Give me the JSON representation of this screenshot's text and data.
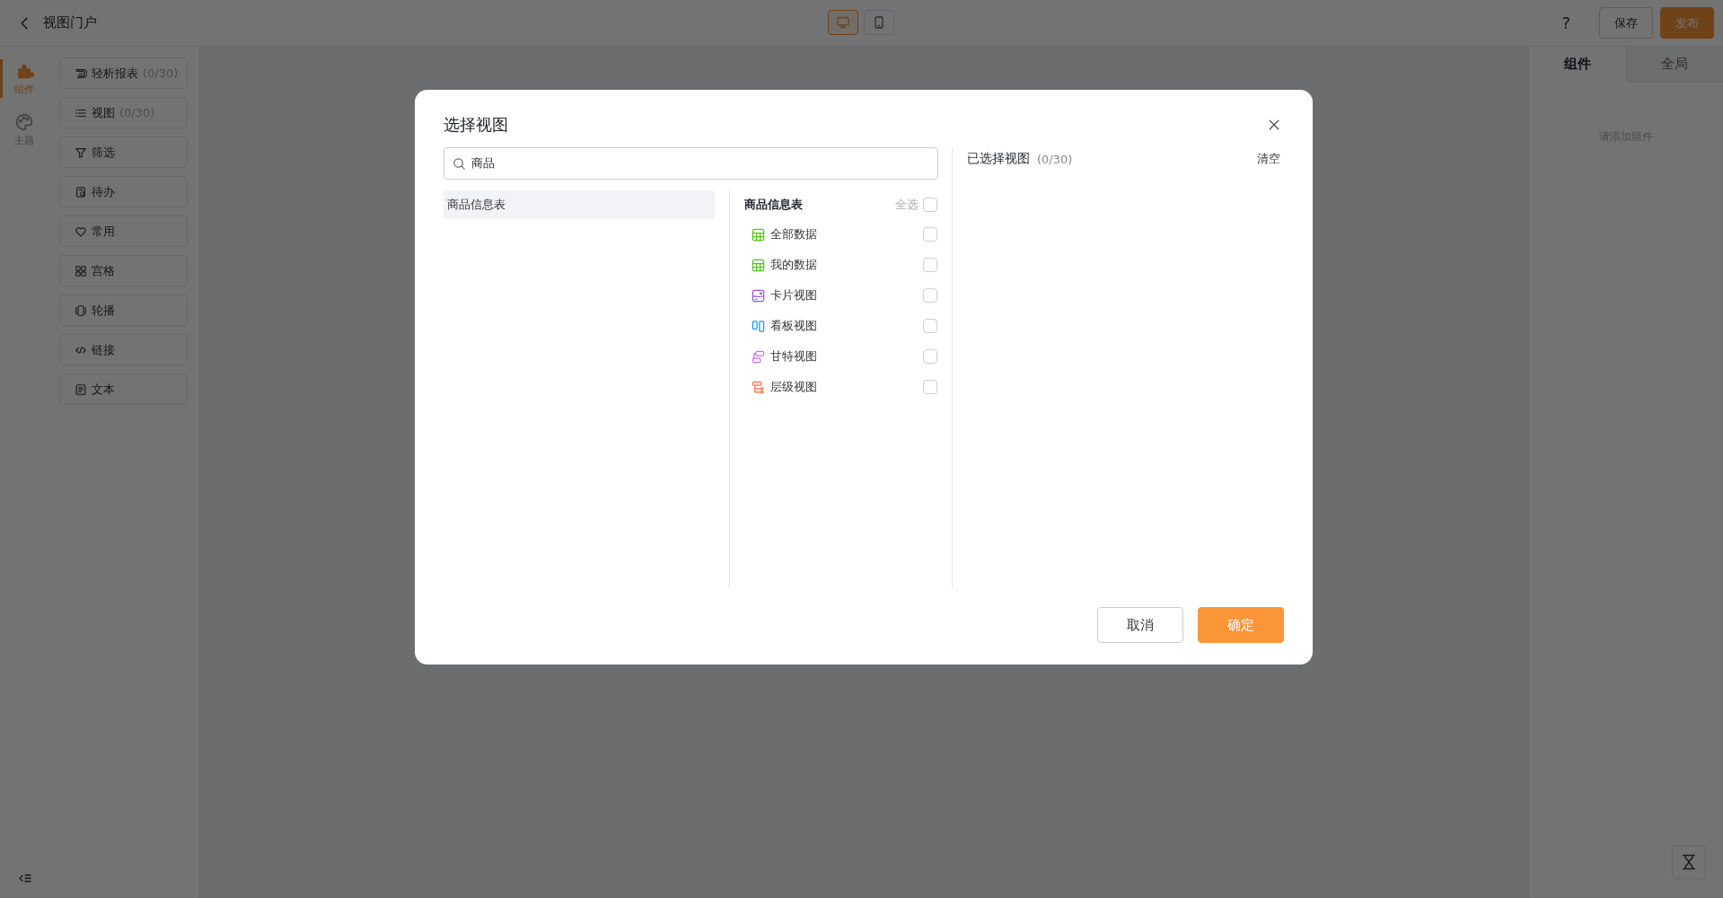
{
  "top_bar": {
    "title": "视图门户",
    "device_toggles": [
      {
        "kind": "desktop",
        "selected": true
      },
      {
        "kind": "mobile",
        "selected": false
      }
    ],
    "help": "?",
    "save": "保存",
    "publish": "发布"
  },
  "rail": [
    {
      "kind": "puzzle",
      "label": "组件",
      "selected": true
    },
    {
      "kind": "palette",
      "label": "主题",
      "selected": false
    }
  ],
  "components": [
    {
      "kind": "report",
      "label": "轻析报表",
      "count": "(0/30)"
    },
    {
      "kind": "list",
      "label": "视图",
      "count": "(0/30)"
    },
    {
      "kind": "filter",
      "label": "筛选"
    },
    {
      "kind": "todo",
      "label": "待办"
    },
    {
      "kind": "heart",
      "label": "常用"
    },
    {
      "kind": "grid",
      "label": "宫格"
    },
    {
      "kind": "carousel",
      "label": "轮播"
    },
    {
      "kind": "code",
      "label": "链接"
    },
    {
      "kind": "text",
      "label": "文本"
    }
  ],
  "right_panel": {
    "tabs": [
      {
        "label": "组件",
        "selected": true
      },
      {
        "label": "全局",
        "selected": false
      }
    ],
    "empty_text": "请添加组件"
  },
  "dialog": {
    "title": "选择视图",
    "search": {
      "value": "商品"
    },
    "tables": [
      {
        "label": "商品信息表",
        "selected": true
      }
    ],
    "views": {
      "heading": "商品信息表",
      "select_all": {
        "label": "全选",
        "checked": false
      },
      "items": [
        {
          "kind": "table",
          "label": "全部数据",
          "checked": false
        },
        {
          "kind": "table",
          "label": "我的数据",
          "checked": false
        },
        {
          "kind": "card",
          "label": "卡片视图",
          "checked": false
        },
        {
          "kind": "kanban",
          "label": "看板视图",
          "checked": false
        },
        {
          "kind": "gantt",
          "label": "甘特视图",
          "checked": false
        },
        {
          "kind": "tree",
          "label": "层级视图",
          "checked": false
        }
      ]
    },
    "selected_panel": {
      "title": "已选择视图",
      "count": "(0/30)",
      "clear": "清空"
    },
    "cancel": "取消",
    "confirm": "确定"
  }
}
